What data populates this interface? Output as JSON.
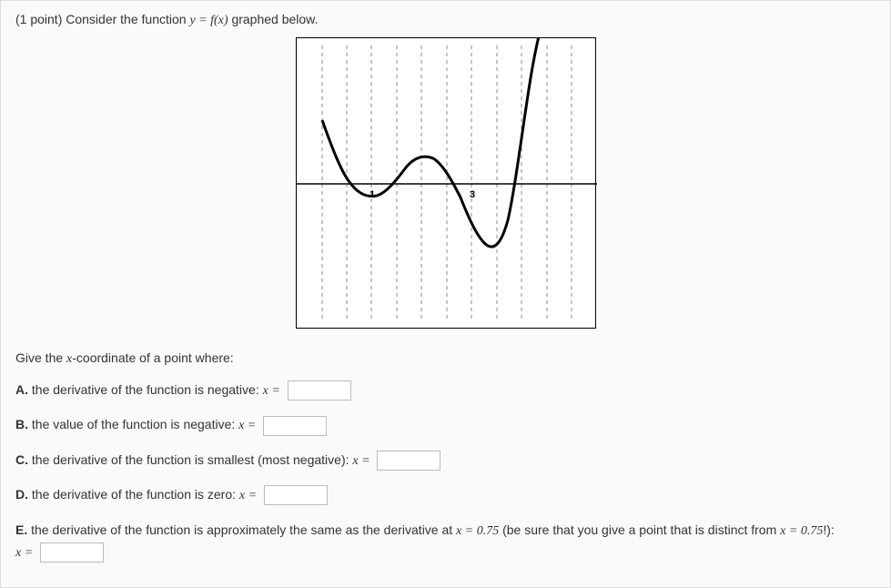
{
  "header": {
    "points": "(1 point)",
    "intro": "Consider the function ",
    "equation": "y = f(x)",
    "suffix": " graphed below."
  },
  "graph": {
    "axis_label_1": "1",
    "axis_label_3": "3"
  },
  "intro": "Give the x-coordinate of a point where:",
  "parts": {
    "A": {
      "label": "A.",
      "text": " the derivative of the function is negative: ",
      "var": "x ="
    },
    "B": {
      "label": "B.",
      "text": " the value of the function is negative: ",
      "var": "x ="
    },
    "C": {
      "label": "C.",
      "text": " the derivative of the function is smallest (most negative): ",
      "var": "x ="
    },
    "D": {
      "label": "D.",
      "text": " the derivative of the function is zero: ",
      "var": "x ="
    },
    "E": {
      "label": "E.",
      "text_before": " the derivative of the function is approximately the same as the derivative at ",
      "value": "x = 0.75",
      "text_mid": " (be sure that you give a point that is distinct from ",
      "value2": "x = 0.75",
      "text_after": "!):",
      "var": "x ="
    }
  },
  "chart_data": {
    "type": "line",
    "title": "",
    "xlabel": "",
    "ylabel": "",
    "x_ticks_visible": [
      1,
      3
    ],
    "xlim": [
      -0.5,
      5.5
    ],
    "ylim": [
      -3,
      3
    ],
    "grid": "vertical-dashed",
    "series": [
      {
        "name": "f(x)",
        "x": [
          0.0,
          0.25,
          0.5,
          0.75,
          1.0,
          1.25,
          1.5,
          1.75,
          2.0,
          2.25,
          2.5,
          2.75,
          3.0,
          3.25,
          3.5,
          3.75,
          4.0,
          4.25
        ],
        "y": [
          1.3,
          0.7,
          0.15,
          -0.15,
          -0.25,
          -0.1,
          0.25,
          0.5,
          0.55,
          0.4,
          0.0,
          -0.55,
          -1.05,
          -1.25,
          -1.0,
          -0.1,
          1.5,
          3.0
        ]
      }
    ]
  }
}
